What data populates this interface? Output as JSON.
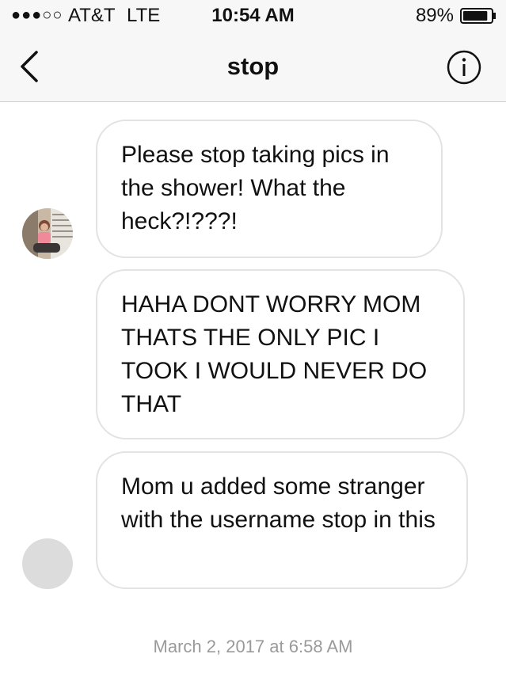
{
  "status_bar": {
    "signal": "●●●○○",
    "carrier": "AT&T",
    "network": "LTE",
    "time": "10:54 AM",
    "battery_percent": "89%",
    "battery_level": 0.89
  },
  "nav": {
    "back_icon": "chevron-left-icon",
    "title": "stop",
    "info_icon": "info-icon"
  },
  "messages": [
    {
      "text": "Please stop taking pics in the shower!  What the heck?!???!"
    },
    {
      "text": "HAHA DONT WORRY MOM THATS THE ONLY PIC I TOOK I WOULD NEVER DO THAT"
    },
    {
      "text": "Mom u added some stranger with the username stop in this"
    }
  ],
  "timestamp": "March 2, 2017 at 6:58 AM",
  "colors": {
    "bar_background": "#f7f7f7",
    "bubble_border": "#e3e3e3",
    "timestamp": "#9a9a9a",
    "avatar_placeholder": "#dcdcdc"
  }
}
